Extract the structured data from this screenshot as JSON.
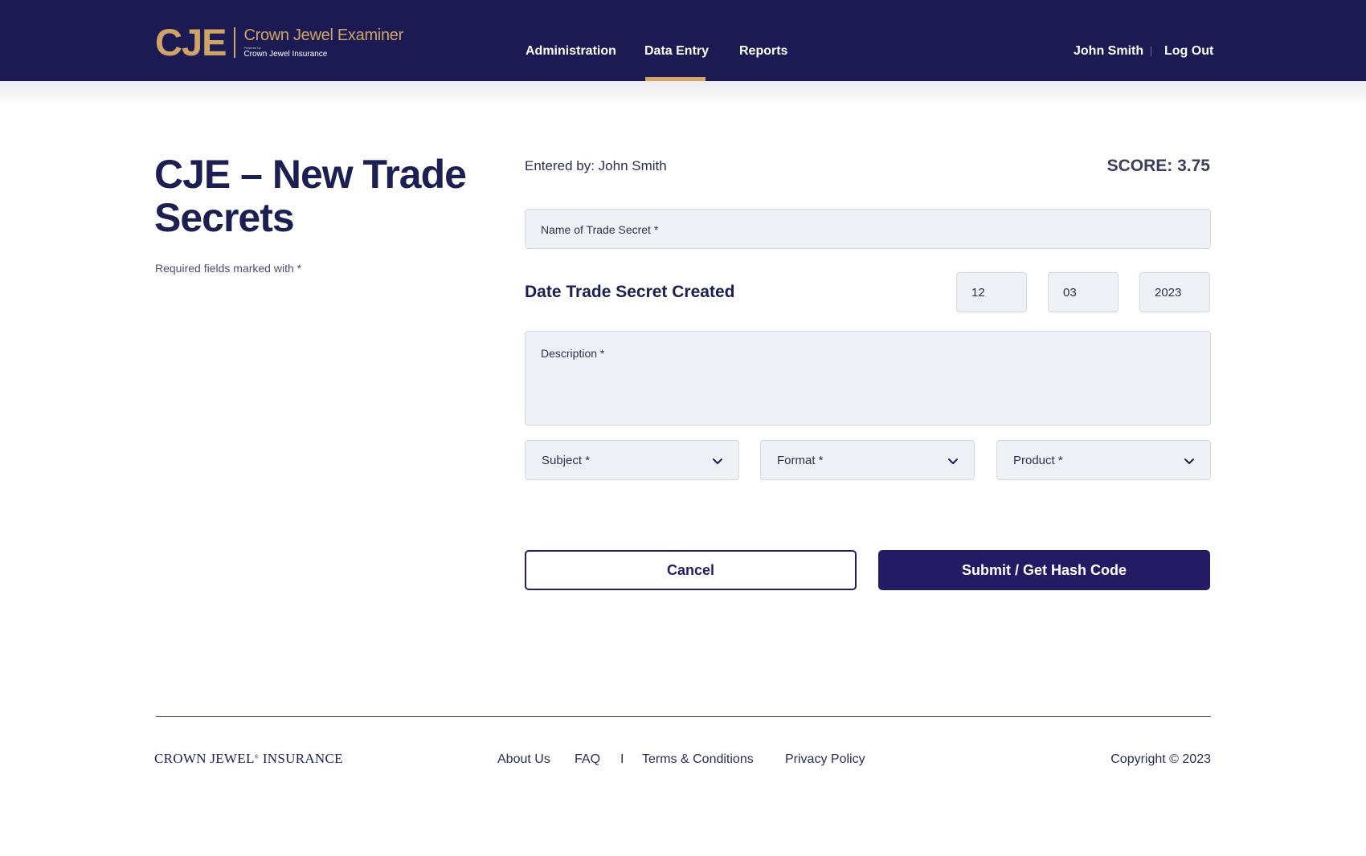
{
  "header": {
    "logo_mark": "CJE",
    "logo_title": "Crown Jewel Examiner",
    "logo_powered": "Powered by",
    "logo_subtitle": "Crown Jewel Insurance",
    "nav": {
      "administration": "Administration",
      "data_entry": "Data Entry",
      "reports": "Reports"
    },
    "active_nav": "Data Entry",
    "user_name": "John Smith",
    "logout": "Log Out"
  },
  "page": {
    "title": "CJE – New Trade Secrets",
    "required_note": "Required fields marked with *"
  },
  "form": {
    "entered_by": "Entered by: John Smith",
    "score": "SCORE: 3.75",
    "name_placeholder": "Name of Trade Secret *",
    "date_label": "Date Trade Secret Created",
    "date_day": "12",
    "date_month": "03",
    "date_year": "2023",
    "description_placeholder": "Description *",
    "subject": "Subject *",
    "format": "Format *",
    "product": "Product *",
    "cancel": "Cancel",
    "submit": "Submit / Get Hash Code"
  },
  "footer": {
    "logo": "CROWN JEWEL",
    "logo_mark": "®",
    "logo_rest": " INSURANCE",
    "about": "About Us",
    "faq": "FAQ",
    "separator": "I",
    "terms": "Terms & Conditions",
    "privacy": "Privacy Policy",
    "copyright": "Copyright © 2023"
  },
  "colors": {
    "header_bg": "#1c1a53",
    "accent_gold": "#cfa468",
    "primary_button": "#231c64",
    "field_bg": "#eef1f5"
  },
  "icons": {
    "select_chevron": "chevron-down-icon"
  }
}
